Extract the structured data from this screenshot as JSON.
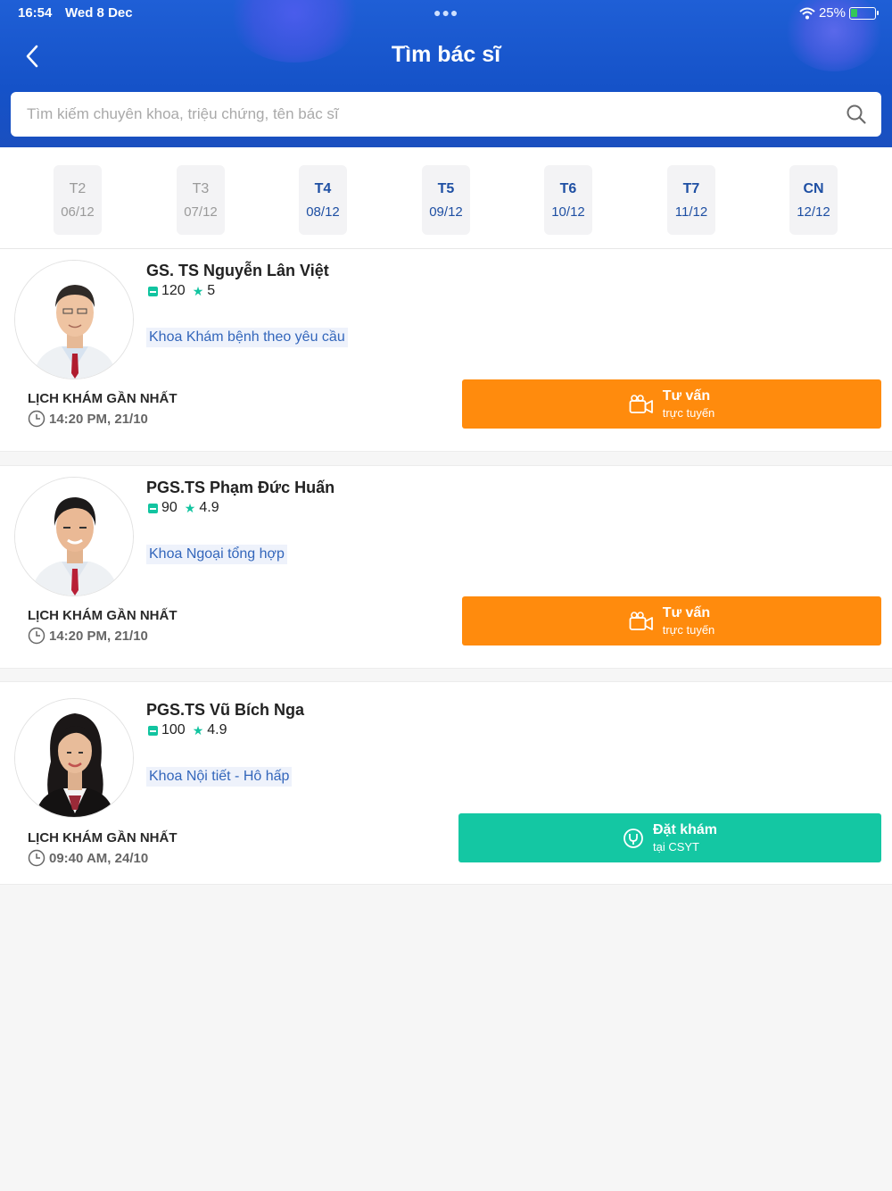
{
  "status_bar": {
    "time": "16:54",
    "date": "Wed 8 Dec",
    "battery": "25%"
  },
  "header": {
    "title": "Tìm bác sĩ",
    "search_placeholder": "Tìm kiếm chuyên khoa, triệu chứng, tên bác sĩ"
  },
  "dates": [
    {
      "day": "T2",
      "date": "06/12",
      "enabled": false
    },
    {
      "day": "T3",
      "date": "07/12",
      "enabled": false
    },
    {
      "day": "T4",
      "date": "08/12",
      "enabled": true
    },
    {
      "day": "T5",
      "date": "09/12",
      "enabled": true
    },
    {
      "day": "T6",
      "date": "10/12",
      "enabled": true
    },
    {
      "day": "T7",
      "date": "11/12",
      "enabled": true
    },
    {
      "day": "CN",
      "date": "12/12",
      "enabled": true
    }
  ],
  "doctors": [
    {
      "name": "GS. TS Nguyễn Lân Việt",
      "bookings": "120",
      "rating": "5",
      "department": "Khoa Khám bệnh theo yêu cầu",
      "schedule_label": "LỊCH KHÁM GẦN NHẤT",
      "schedule_time": "14:20 PM, 21/10",
      "action_title": "Tư vấn",
      "action_subtitle": "trực tuyến",
      "action_color": "#ff8b0d"
    },
    {
      "name": "PGS.TS Phạm Đức Huấn",
      "bookings": "90",
      "rating": "4.9",
      "department": "Khoa Ngoại tổng hợp",
      "schedule_label": "LỊCH KHÁM GẦN NHẤT",
      "schedule_time": "14:20 PM, 21/10",
      "action_title": "Tư vấn",
      "action_subtitle": "trực tuyến",
      "action_color": "#ff8b0d"
    },
    {
      "name": "PGS.TS Vũ Bích Nga",
      "bookings": "100",
      "rating": "4.9",
      "department": "Khoa Nội tiết - Hô hấp",
      "schedule_label": "LỊCH KHÁM GẦN NHẤT",
      "schedule_time": "09:40 AM, 24/10",
      "action_title": "Đặt khám",
      "action_subtitle": "tại CSYT",
      "action_color": "#14c7a3"
    }
  ],
  "colors": {
    "primary": "#1552c8",
    "orange": "#ff8b0d",
    "teal": "#14c7a3",
    "link": "#3366bb"
  }
}
